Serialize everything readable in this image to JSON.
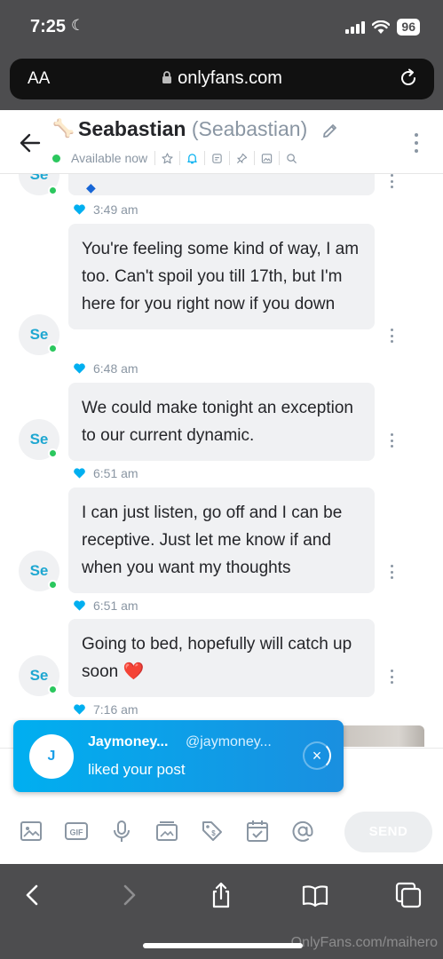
{
  "status_bar": {
    "time": "7:25",
    "battery": "96"
  },
  "browser": {
    "text_size_label": "AA",
    "domain": "onlyfans.com"
  },
  "chat": {
    "user_name": "Seabastian",
    "user_nickname": "(Seabastian)",
    "availability": "Available now"
  },
  "messages": [
    {
      "avatar": "Se",
      "text": "",
      "time": "3:49 am"
    },
    {
      "avatar": "Se",
      "text": "You're feeling some kind of way, I am too. Can't spoil you till 17th, but I'm here for you right now if you down",
      "time": "6:48 am"
    },
    {
      "avatar": "Se",
      "text": "We could make tonight an exception to our current dynamic.",
      "time": "6:51 am"
    },
    {
      "avatar": "Se",
      "text": "I can just listen, go off and I can be receptive. Just let me know if and when you want my thoughts",
      "time": "6:51 am"
    },
    {
      "avatar": "Se",
      "text": "Going to bed, hopefully will catch up soon ❤️",
      "time": "7:16 am"
    }
  ],
  "notification": {
    "avatar": "J",
    "name": "Jaymoney...",
    "handle": "@jaymoney...",
    "text": "liked your post",
    "close": "×"
  },
  "composer": {
    "send_label": "SEND"
  },
  "watermark": "OnlyFans.com/maihero",
  "colors": {
    "accent": "#00aff0",
    "online": "#2bc75e",
    "bubble": "#f0f1f3",
    "muted": "#8a96a3"
  }
}
